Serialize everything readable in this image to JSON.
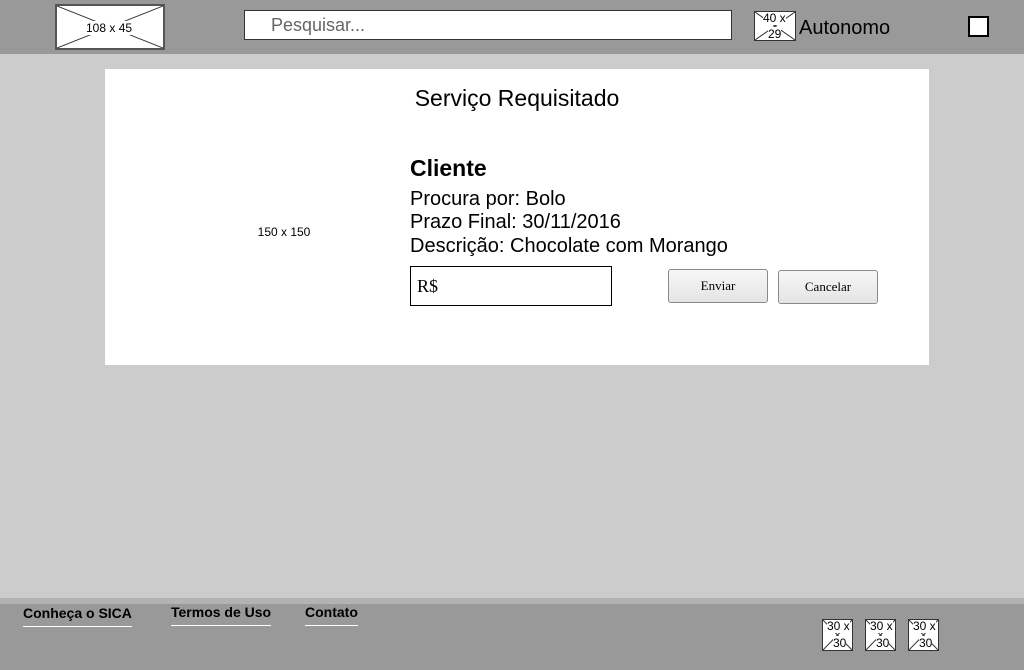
{
  "header": {
    "logo_placeholder": "108 x 45",
    "search_placeholder": "Pesquisar...",
    "avatar_placeholder_top": "40 x",
    "avatar_placeholder_bottom": "29",
    "user_name": "Autonomo"
  },
  "card": {
    "title": "Serviço Requisitado",
    "image_placeholder": "150 x 150",
    "client_heading": "Cliente",
    "lines": [
      "Procura por: Bolo",
      "Prazo Final: 30/11/2016",
      "Descrição: Chocolate com Morango"
    ],
    "price_prefix": "R$",
    "price_value": "",
    "send_label": "Enviar",
    "cancel_label": "Cancelar"
  },
  "footer": {
    "links": [
      "Conheça o SICA",
      "Termos de Uso",
      "Contato"
    ],
    "social_placeholder_top": "30 x",
    "social_placeholder_bottom": "30"
  }
}
